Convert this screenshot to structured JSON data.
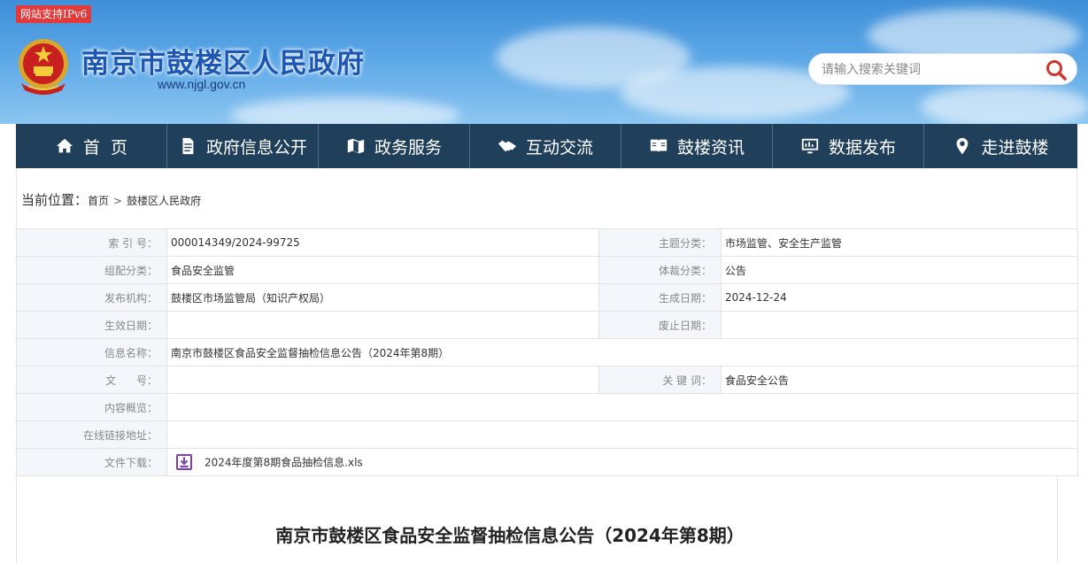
{
  "header": {
    "ipv6_badge": "网站支持IPv6",
    "site_title": "南京市鼓楼区人民政府",
    "site_url": "www.njgl.gov.cn",
    "search_placeholder": "请输入搜索关键词",
    "search_icon": "search-icon",
    "colors": {
      "title": "#1d56b3",
      "badge": "#e23a3a",
      "search_icon": "#d0352f"
    }
  },
  "nav": {
    "background": "#1f3f5a",
    "items": [
      {
        "label": "首  页",
        "icon": "home-icon"
      },
      {
        "label": "政府信息公开",
        "icon": "document-icon"
      },
      {
        "label": "政务服务",
        "icon": "map-icon"
      },
      {
        "label": "互动交流",
        "icon": "handshake-icon"
      },
      {
        "label": "鼓楼资讯",
        "icon": "book-icon"
      },
      {
        "label": "数据发布",
        "icon": "monitor-chart-icon"
      },
      {
        "label": "走进鼓楼",
        "icon": "location-pin-icon"
      }
    ]
  },
  "breadcrumb": {
    "label": "当前位置：",
    "items": [
      "首页",
      "鼓楼区人民政府"
    ],
    "separator": ">"
  },
  "info": {
    "index_no_label": "索 引 号：",
    "index_no": "000014349/2024-99725",
    "topic_label": "主题分类：",
    "topic": "市场监管、安全生产监管",
    "category_label": "组配分类：",
    "category": "食品安全监管",
    "genre_label": "体裁分类：",
    "genre": "公告",
    "publisher_label": "发布机构：",
    "publisher": "鼓楼区市场监管局（知识产权局）",
    "created_label": "生成日期：",
    "created": "2024-12-24",
    "effective_label": "生效日期：",
    "effective": "",
    "expiry_label": "废止日期：",
    "expiry": "",
    "name_label": "信息名称：",
    "name": "南京市鼓楼区食品安全监督抽检信息公告（2024年第8期）",
    "doc_no_label": "文      号：",
    "doc_no": "",
    "keywords_label": "关 键 词：",
    "keywords": "食品安全公告",
    "summary_label": "内容概览：",
    "summary": "",
    "link_label": "在线链接地址：",
    "link": "",
    "download_label": "文件下载：",
    "download_file": "2024年度第8期食品抽检信息.xls",
    "download_icon": "download-icon"
  },
  "article": {
    "title": "南京市鼓楼区食品安全监督抽检信息公告（2024年第8期）"
  }
}
